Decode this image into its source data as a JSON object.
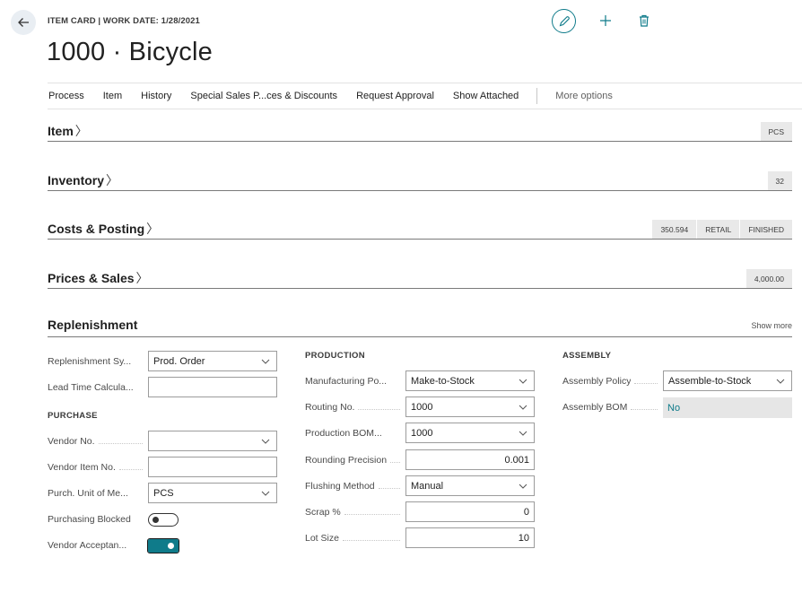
{
  "header": {
    "caption": "ITEM CARD | WORK DATE: 1/28/2021",
    "title": "1000 · Bicycle"
  },
  "actions": {
    "items": [
      "Process",
      "Item",
      "History",
      "Special Sales P...ces & Discounts",
      "Request Approval",
      "Show Attached"
    ],
    "more": "More options"
  },
  "sections": {
    "item": {
      "title": "Item",
      "chevron": "〉",
      "badges": [
        "PCS"
      ]
    },
    "inventory": {
      "title": "Inventory",
      "chevron": "〉",
      "badges": [
        "32"
      ]
    },
    "costs": {
      "title": "Costs & Posting",
      "chevron": "〉",
      "badges": [
        "350.594",
        "RETAIL",
        "FINISHED"
      ]
    },
    "prices": {
      "title": "Prices & Sales",
      "chevron": "〉",
      "badges": [
        "4,000.00"
      ]
    },
    "replenishment": {
      "title": "Replenishment",
      "show_more": "Show more"
    }
  },
  "replenishment": {
    "general": {
      "replenishment_system": {
        "label": "Replenishment Sy...",
        "value": "Prod. Order"
      },
      "lead_time": {
        "label": "Lead Time Calcula...",
        "value": ""
      }
    },
    "purchase": {
      "heading": "PURCHASE",
      "vendor_no": {
        "label": "Vendor No.",
        "value": ""
      },
      "vendor_item_no": {
        "label": "Vendor Item No.",
        "value": ""
      },
      "purch_uom": {
        "label": "Purch. Unit of Me...",
        "value": "PCS"
      },
      "purchasing_blocked": {
        "label": "Purchasing Blocked",
        "on": false
      },
      "vendor_acceptance": {
        "label": "Vendor Acceptan...",
        "on": true
      }
    },
    "production": {
      "heading": "PRODUCTION",
      "manufacturing_policy": {
        "label": "Manufacturing Po...",
        "value": "Make-to-Stock"
      },
      "routing_no": {
        "label": "Routing No.",
        "value": "1000"
      },
      "production_bom": {
        "label": "Production BOM...",
        "value": "1000"
      },
      "rounding_precision": {
        "label": "Rounding Precision",
        "value": "0.001"
      },
      "flushing_method": {
        "label": "Flushing Method",
        "value": "Manual"
      },
      "scrap": {
        "label": "Scrap %",
        "value": "0"
      },
      "lot_size": {
        "label": "Lot Size",
        "value": "10"
      }
    },
    "assembly": {
      "heading": "ASSEMBLY",
      "assembly_policy": {
        "label": "Assembly Policy",
        "value": "Assemble-to-Stock"
      },
      "assembly_bom": {
        "label": "Assembly BOM",
        "value": "No"
      }
    }
  },
  "icons": {
    "back": "back-arrow-icon",
    "edit": "pencil-icon",
    "new": "plus-icon",
    "delete": "trash-icon",
    "dropdown": "chevron-down-icon"
  },
  "colors": {
    "accent": "#0f7b8a",
    "badge_bg": "#e9e9e9",
    "readonly_bg": "#e6e6e6"
  }
}
